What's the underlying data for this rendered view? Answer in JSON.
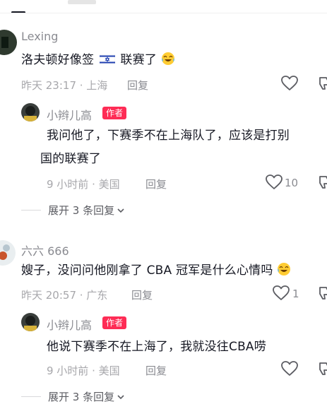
{
  "comments": [
    {
      "user": "Lexing",
      "text": "洛夫顿好像签",
      "text_suffix": "联赛了",
      "time": "昨天 23:17 · 上海",
      "reply_label": "回复",
      "likes": "",
      "replies": [
        {
          "user": "小辫儿高",
          "badge": "作者",
          "line1": "我问他了，下赛季不在上海队了，应该是打别",
          "line2": "国的联赛了",
          "time": "9 小时前 · 美国",
          "reply_label": "回复",
          "likes": "10"
        }
      ],
      "expand_label": "展开 3 条回复"
    },
    {
      "user": "六六 666",
      "text": "嫂子，没问问他刚拿了 CBA 冠军是什么心情吗",
      "time": "昨天 20:57 · 广东",
      "reply_label": "回复",
      "likes": "1",
      "replies": [
        {
          "user": "小辫儿高",
          "badge": "作者",
          "line1": "他说下赛季不在上海了，我就没往CBA唠",
          "time": "9 小时前 · 美国",
          "reply_label": "回复",
          "likes": ""
        }
      ],
      "expand_label": "展开 3 条回复"
    }
  ],
  "icons": {
    "heart": "heart-icon",
    "flag": "israel-flag-icon",
    "emoji": "laughing-crying-emoji-icon",
    "chevron": "chevron-down-icon"
  },
  "colors": {
    "badge": "#fe2c55",
    "text": "#161823",
    "meta": "#a7a7ab"
  }
}
